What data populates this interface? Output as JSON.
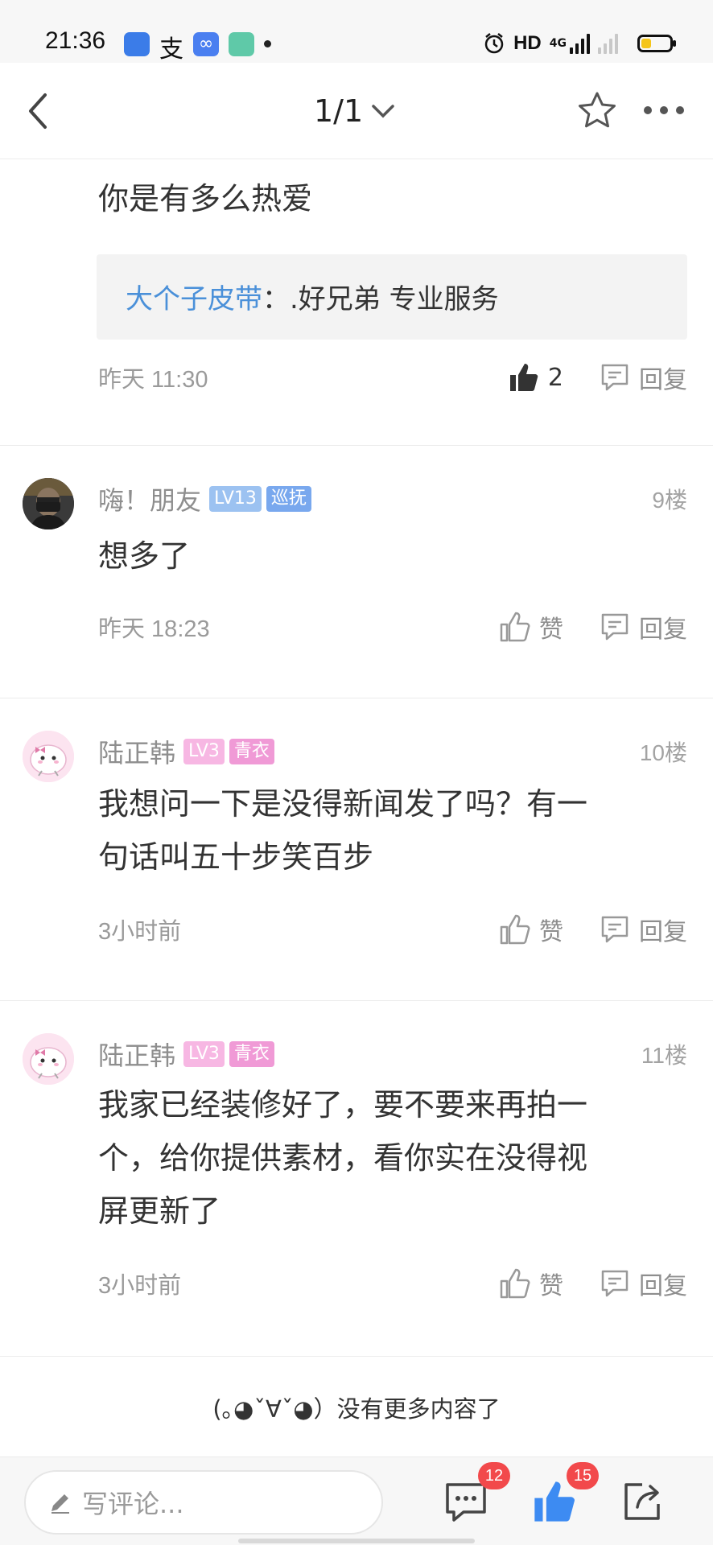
{
  "status_bar": {
    "time": "21:36",
    "network": "HD",
    "signal_type": "4G",
    "icons": [
      "app-icon-blue",
      "alipay-icon",
      "infinity-icon",
      "green-app-icon",
      "alarm-icon",
      "battery-icon"
    ]
  },
  "nav": {
    "page_indicator": "1/1",
    "icons": [
      "back-arrow-icon",
      "chevron-down-icon",
      "star-icon",
      "more-icon"
    ]
  },
  "comments": [
    {
      "body": "你是有多么热爱",
      "quote": {
        "author": "大个子皮带",
        "separator": "：",
        "text": ".好兄弟 专业服务"
      },
      "time": "昨天 11:30",
      "like_label": "2",
      "reply_label": "回复"
    },
    {
      "username": "嗨！朋友",
      "level": "LV13",
      "title_badge": "巡抚",
      "floor": "9楼",
      "body": "想多了",
      "time": "昨天 18:23",
      "like_label": "赞",
      "reply_label": "回复"
    },
    {
      "username": "陆正韩",
      "level": "LV3",
      "title_badge": "青衣",
      "floor": "10楼",
      "body_lines": [
        "我想问一下是没得新闻发了吗？有一",
        "句话叫五十步笑百步"
      ],
      "time": "3小时前",
      "like_label": "赞",
      "reply_label": "回复"
    },
    {
      "username": "陆正韩",
      "level": "LV3",
      "title_badge": "青衣",
      "floor": "11楼",
      "body_lines": [
        "我家已经装修好了，要不要来再拍一",
        "个，给你提供素材，看你实在没得视",
        "屏更新了"
      ],
      "time": "3小时前",
      "like_label": "赞",
      "reply_label": "回复"
    }
  ],
  "end_message": "(｡◕ˇ∀ˇ◕）没有更多内容了",
  "bottom_bar": {
    "comment_placeholder": "写评论...",
    "comment_count": "12",
    "like_count": "15"
  },
  "colors": {
    "link_blue": "#4a90d9",
    "badge_blue": "#8ab6ee",
    "badge_pink": "#f3a6dc",
    "count_red": "#f2494b",
    "like_blue": "#3d8bf2"
  }
}
